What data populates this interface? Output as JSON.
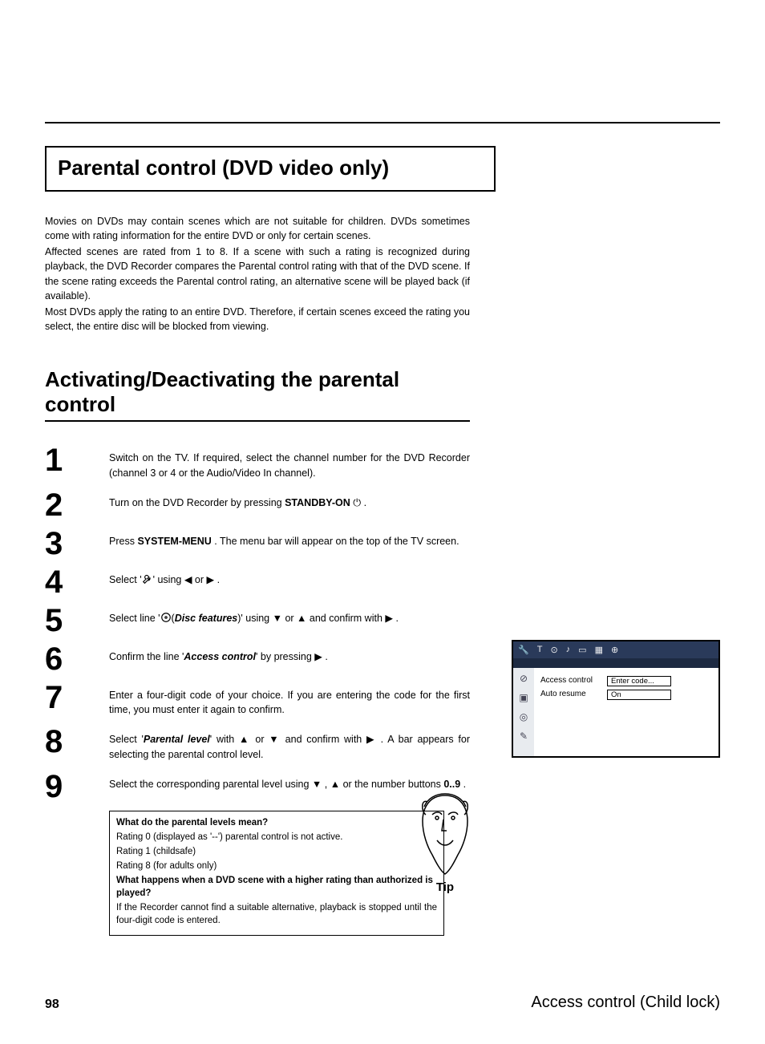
{
  "header": {
    "boxed_title": "Parental control (DVD video only)"
  },
  "intro": {
    "p1": "Movies on DVDs may contain scenes which are not suitable for children. DVDs sometimes come with rating information for the entire DVD or only for certain scenes.",
    "p2": "Affected scenes are rated from 1 to 8. If a scene with such a rating is recognized during playback, the DVD Recorder compares the Parental control rating with that of the DVD scene. If the scene rating exceeds the Parental control rating, an alternative scene will be played back (if available).",
    "p3": "Most DVDs apply the rating to an entire DVD. Therefore, if certain scenes exceed the rating you select, the entire disc will be blocked from viewing."
  },
  "section": {
    "title": "Activating/Deactivating the parental control"
  },
  "steps": [
    {
      "n": "1",
      "pre": "Switch on the TV. If required, select the channel number for the DVD Recorder (channel 3 or 4 or the Audio/Video In channel)."
    },
    {
      "n": "2",
      "pre": "Turn on the DVD Recorder by pressing ",
      "b1": "STANDBY-ON",
      "post": " ⏻ ."
    },
    {
      "n": "3",
      "pre": "Press ",
      "b1": "SYSTEM-MENU",
      "post": " . The menu bar will appear on the top of the TV screen."
    },
    {
      "n": "4",
      "pre": "Select '",
      "mid": "' using  ◀  or  ▶ ."
    },
    {
      "n": "5",
      "pre": "Select line '",
      "bi": "Disc features",
      "mid2": ")' using  ▼  or  ▲  and confirm with  ▶ ."
    },
    {
      "n": "6",
      "pre": "Confirm the line '",
      "bi": "Access control",
      "post": "' by pressing  ▶ ."
    },
    {
      "n": "7",
      "pre": "Enter a four-digit code of your choice. If you are entering the code for the first time, you must enter it again to confirm."
    },
    {
      "n": "8",
      "pre": "Select '",
      "bi": "Parental level",
      "post": "' with  ▲  or  ▼  and confirm with  ▶ . A bar appears for selecting the parental control level."
    },
    {
      "n": "9",
      "pre": "Select the corresponding parental level using  ▼ ,  ▲  or the number buttons ",
      "b1": "0..9",
      "post": " ."
    }
  ],
  "tip": {
    "q1": "What do the parental levels mean?",
    "a1": "Rating 0 (displayed as '--') parental control is not active.",
    "a2": "Rating 1 (childsafe)",
    "a3": "Rating 8 (for adults only)",
    "q2": "What happens when a DVD scene with a higher rating than authorized is played?",
    "a4": "If the Recorder cannot find a suitable alternative, playback is stopped until the four-digit code is entered."
  },
  "tip_label": "Tip",
  "osd": {
    "labels": {
      "l1": "Access control",
      "l2": "Auto resume"
    },
    "fields": {
      "f1": "Enter code...",
      "f2": "On"
    }
  },
  "footer": {
    "page_num": "98",
    "title": "Access control (Child lock)"
  }
}
